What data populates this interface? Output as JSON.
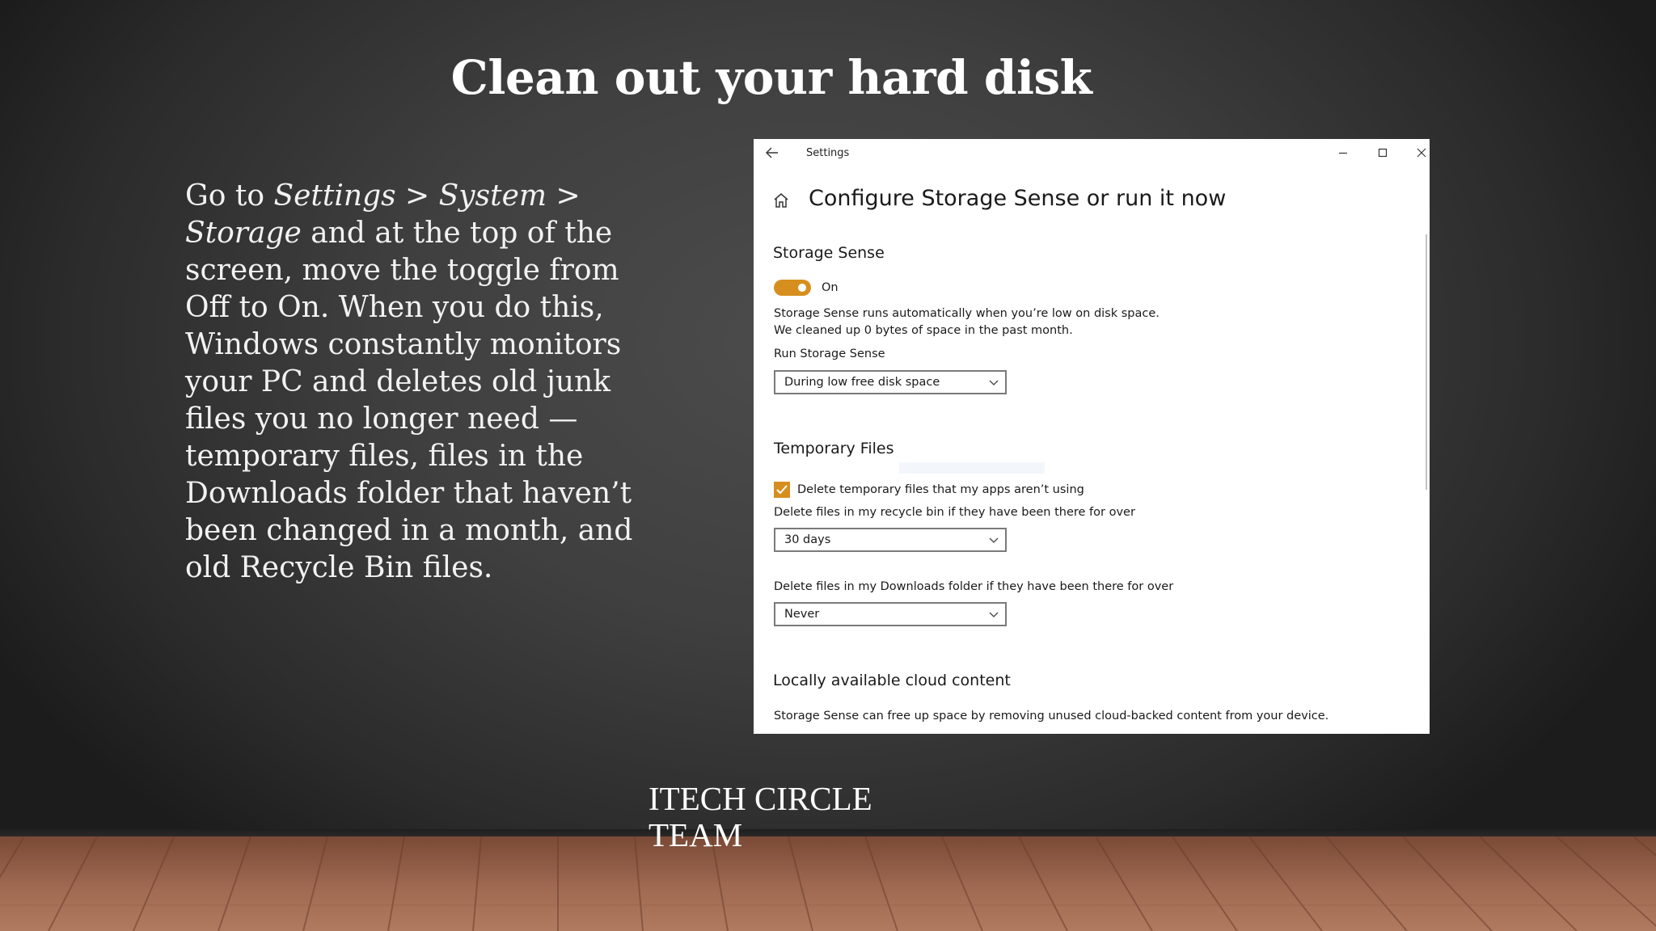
{
  "slide": {
    "title": "Clean out your hard disk",
    "body": {
      "p1": "Go to ",
      "path": "Settings > System > Storage",
      "p2": " and at the top of the screen, move the toggle from Off to On. When you do this, Windows constantly monitors your PC and deletes old junk files you no longer need — temporary files, files in the Downloads folder that haven’t been changed in a month, and old Recycle Bin files."
    },
    "team_line1": "ITECH CIRCLE",
    "team_line2": "TEAM"
  },
  "window": {
    "title": "Settings",
    "heading": "Configure Storage Sense or run it now",
    "storage_sense": {
      "section_title": "Storage Sense",
      "toggle_label": "On",
      "toggle_on": true,
      "description_line1": "Storage Sense runs automatically when you’re low on disk space.",
      "description_line2": "We cleaned up 0 bytes of space in the past month.",
      "run_label": "Run Storage Sense",
      "run_value": "During low free disk space"
    },
    "temporary_files": {
      "section_title": "Temporary Files",
      "checkbox_label": "Delete temporary files that my apps aren’t using",
      "checkbox_checked": true,
      "recycle_label": "Delete files in my recycle bin if they have been there for over",
      "recycle_value": "30 days",
      "downloads_label": "Delete files in my Downloads folder if they have been there for over",
      "downloads_value": "Never"
    },
    "cloud": {
      "section_title": "Locally available cloud content",
      "description": "Storage Sense can free up space by removing unused cloud-backed content from your device."
    }
  },
  "icons": [
    "back-arrow-icon",
    "minimize-icon",
    "maximize-icon",
    "close-icon",
    "home-icon",
    "chevron-down-icon",
    "checkmark-icon"
  ],
  "colors": {
    "accent": "#d68f1f",
    "window_bg": "#ffffff",
    "stage_bg": "#3f3f3f",
    "floor": "#a06a52"
  }
}
